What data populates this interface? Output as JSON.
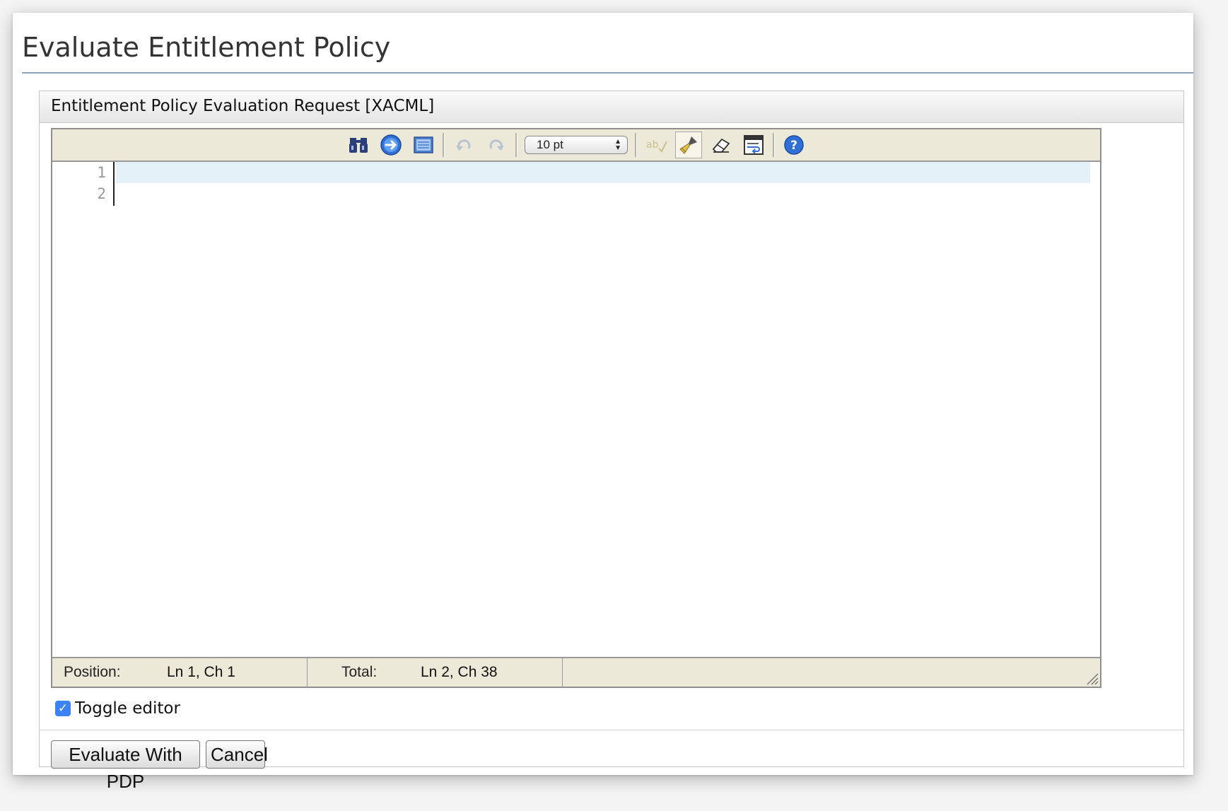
{
  "page": {
    "title": "Evaluate Entitlement Policy"
  },
  "panel": {
    "title": "Entitlement Policy Evaluation Request [XACML]"
  },
  "toolbar": {
    "font_size": "10 pt",
    "icons": [
      "search-icon",
      "goto-line-icon",
      "fullscreen-icon",
      "undo-icon",
      "redo-icon",
      "spellcheck-icon",
      "highlight-icon",
      "reset-icon",
      "word-wrap-icon",
      "help-icon"
    ]
  },
  "editor": {
    "line_numbers": [
      "1",
      "2"
    ]
  },
  "status": {
    "position_label": "Position:",
    "position_value": "Ln 1, Ch 1",
    "total_label": "Total:",
    "total_value": "Ln 2, Ch 38"
  },
  "toggle": {
    "label": "Toggle editor",
    "checked": true
  },
  "buttons": {
    "evaluate": "Evaluate With PDP",
    "cancel": "Cancel"
  },
  "colors": {
    "toolbar_bg": "#ece9d8",
    "active_line": "#e4f1f8",
    "checkbox": "#3b82f6"
  }
}
